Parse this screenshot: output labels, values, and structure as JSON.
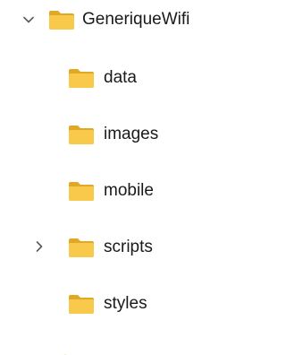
{
  "tree": {
    "root": {
      "label": "GeneriqueWifi",
      "expanded": true,
      "folder_color": "#F2B833"
    },
    "children": [
      {
        "label": "data",
        "has_children": false
      },
      {
        "label": "images",
        "has_children": false
      },
      {
        "label": "mobile",
        "has_children": false
      },
      {
        "label": "scripts",
        "has_children": true,
        "expanded": false
      },
      {
        "label": "styles",
        "has_children": false
      }
    ]
  },
  "icons": {
    "expanded": "chevron-down-icon",
    "collapsed": "chevron-right-icon",
    "folder": "folder-icon"
  },
  "colors": {
    "folder_front": "#F8C94A",
    "folder_back": "#E2A823",
    "chevron": "#5a5a5a",
    "text": "#1a1a1a"
  }
}
